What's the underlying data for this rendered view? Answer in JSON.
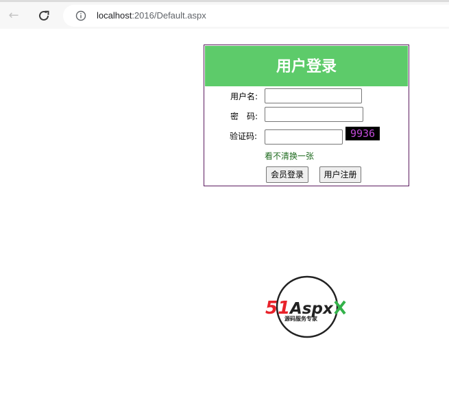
{
  "browser": {
    "url_host": "localhost",
    "url_path": ":2016/Default.aspx"
  },
  "login": {
    "title": "用户登录",
    "username_label": "用户名:",
    "password_label": "密　码:",
    "captcha_label": "验证码:",
    "username_value": "",
    "password_value": "",
    "captcha_value": "",
    "captcha_text": "9936",
    "refresh_link": "看不清换一张",
    "login_button": "会员登录",
    "register_button": "用户注册"
  },
  "logo": {
    "brand_red": "51",
    "brand_black": "Aspx",
    "tagline": "源码服务专家",
    "colors": {
      "red": "#e8222a",
      "green": "#33b24a",
      "dark": "#222222"
    }
  },
  "colors": {
    "header_green": "#5dcb6a",
    "box_border": "#5b1a5e",
    "link_green": "#1f6b1f",
    "captcha_text": "#c04ad8"
  }
}
